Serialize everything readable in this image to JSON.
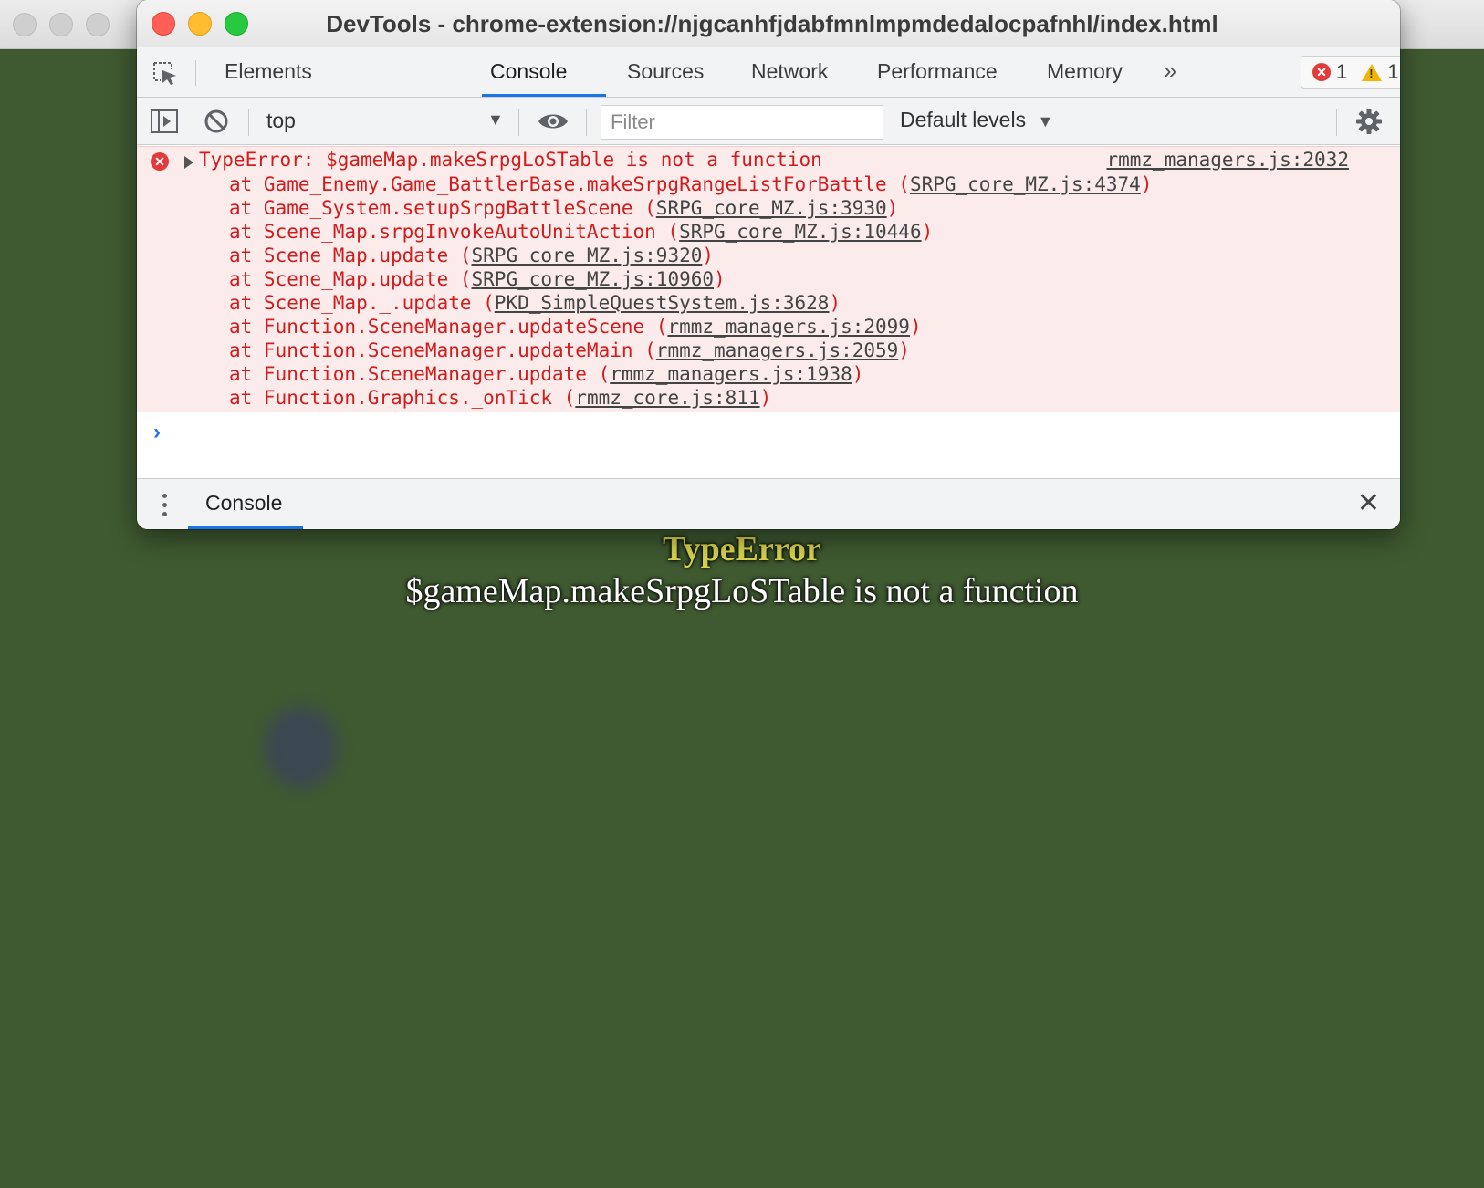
{
  "devtools": {
    "title": "DevTools - chrome-extension://njgcanhfjdabfmnlmpmdedalocpafnhl/index.html",
    "tabs": [
      {
        "label": "Elements"
      },
      {
        "label": "Console"
      },
      {
        "label": "Sources"
      },
      {
        "label": "Network"
      },
      {
        "label": "Performance"
      },
      {
        "label": "Memory"
      }
    ],
    "active_tab": "Console",
    "more_tabs_glyph": "»",
    "error_count": "1",
    "warning_count": "1"
  },
  "console_toolbar": {
    "context": "top",
    "filter_placeholder": "Filter",
    "levels": "Default levels"
  },
  "console": {
    "error": {
      "message": "TypeError: $gameMap.makeSrpgLoSTable is not a function",
      "source": "rmmz_managers.js:2032",
      "stack": [
        {
          "text": "at Game_Enemy.Game_BattlerBase.makeSrpgRangeListForBattle (",
          "link": "SRPG_core_MZ.js:4374",
          "close": ")"
        },
        {
          "text": "at Game_System.setupSrpgBattleScene (",
          "link": "SRPG_core_MZ.js:3930",
          "close": ")"
        },
        {
          "text": "at Scene_Map.srpgInvokeAutoUnitAction (",
          "link": "SRPG_core_MZ.js:10446",
          "close": ")"
        },
        {
          "text": "at Scene_Map.update (",
          "link": "SRPG_core_MZ.js:9320",
          "close": ")"
        },
        {
          "text": "at Scene_Map.update (",
          "link": "SRPG_core_MZ.js:10960",
          "close": ")"
        },
        {
          "text": "at Scene_Map._.update (",
          "link": "PKD_SimpleQuestSystem.js:3628",
          "close": ")"
        },
        {
          "text": "at Function.SceneManager.updateScene (",
          "link": "rmmz_managers.js:2099",
          "close": ")"
        },
        {
          "text": "at Function.SceneManager.updateMain (",
          "link": "rmmz_managers.js:2059",
          "close": ")"
        },
        {
          "text": "at Function.SceneManager.update (",
          "link": "rmmz_managers.js:1938",
          "close": ")"
        },
        {
          "text": "at Function.Graphics._onTick (",
          "link": "rmmz_core.js:811",
          "close": ")"
        }
      ]
    },
    "prompt_glyph": "›"
  },
  "drawer": {
    "tab": "Console",
    "close_glyph": "✕"
  },
  "game": {
    "error_title": "TypeError",
    "error_message": "$gameMap.makeSrpgLoSTable is not a function"
  },
  "colors": {
    "game_background": "#3f5a31",
    "error_text": "#d11d1d",
    "error_background": "#fcebeb",
    "accent": "#1a73e8",
    "error_title_yellow": "#d9d34a"
  }
}
